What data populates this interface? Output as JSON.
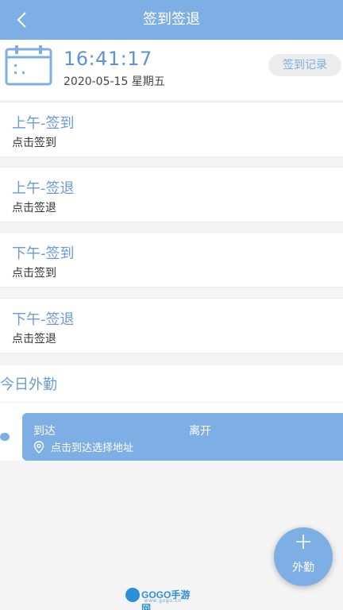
{
  "header": {
    "title": "签到签退"
  },
  "time_card": {
    "clock": "16:41:17",
    "date": "2020-05-15 星期五",
    "records_label": "签到记录"
  },
  "punches": [
    {
      "title": "上午-签到",
      "action": "点击签到"
    },
    {
      "title": "上午-签退",
      "action": "点击签退"
    },
    {
      "title": "下午-签到",
      "action": "点击签到"
    },
    {
      "title": "下午-签退",
      "action": "点击签退"
    }
  ],
  "outing": {
    "title": "今日外勤",
    "arrive_label": "到达",
    "leave_label": "离开",
    "location_hint": "点击到达选择地址"
  },
  "fab": {
    "label": "外勤"
  },
  "watermark": {
    "brand": "GOGO手游网",
    "domain": "www.gogo.cn"
  },
  "colors": {
    "accent": "#7daee4",
    "title_text": "#6a9bd4"
  },
  "icons": {
    "back": "chevron-left-icon",
    "calendar": "calendar-icon",
    "location": "map-pin-icon",
    "add": "plus-icon"
  }
}
